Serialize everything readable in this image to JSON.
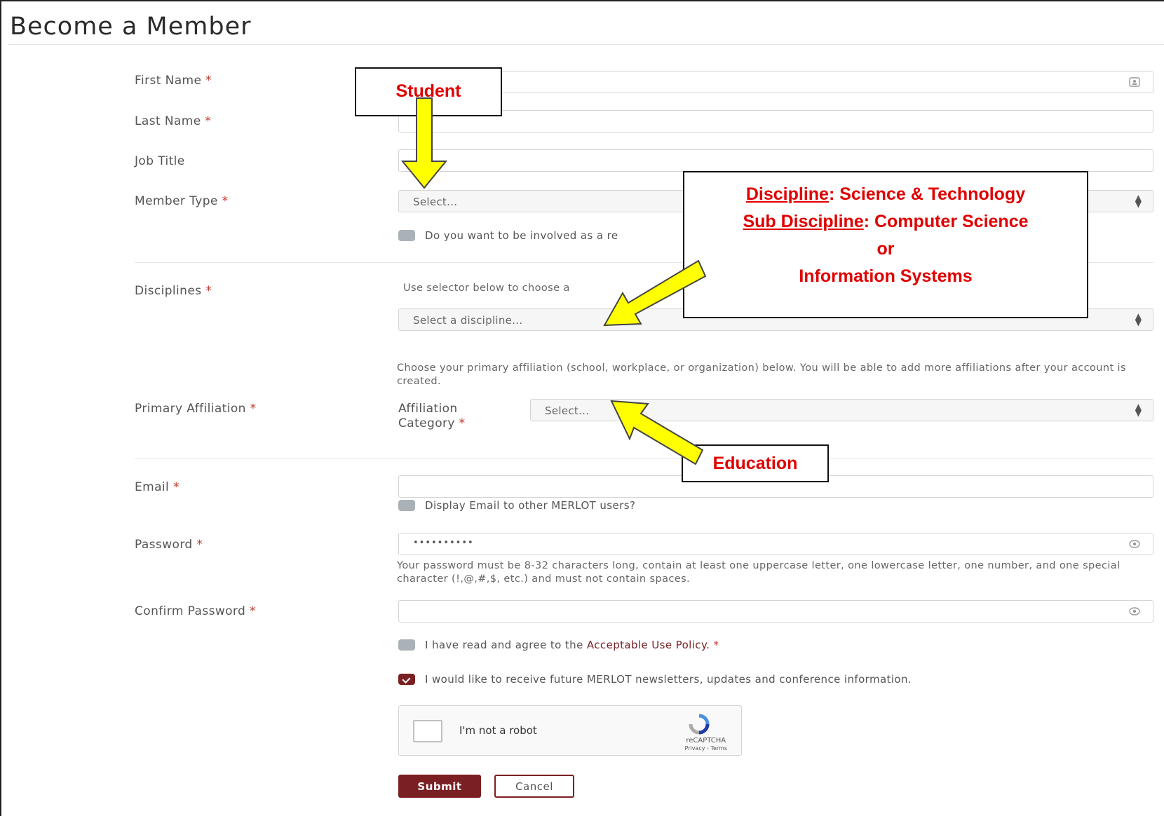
{
  "page": {
    "title": "Become a Member"
  },
  "form": {
    "first_name_label": "First Name",
    "last_name_label": "Last Name",
    "job_title_label": "Job Title",
    "member_type_label": "Member Type",
    "member_type_value": "Select...",
    "reviewer_checkbox_label": "Do you want to be involved as a re",
    "disciplines_label": "Disciplines",
    "disciplines_help": "Use selector below to choose a",
    "discipline_select_value": "Select a discipline...",
    "affiliation_help": "Choose your primary affiliation (school, workplace, or organization) below. You will be able to add more affiliations after your account is created.",
    "primary_affiliation_label": "Primary Affiliation",
    "affiliation_category_label_1": "Affiliation",
    "affiliation_category_label_2": "Category",
    "affiliation_category_value": "Select...",
    "email_label": "Email",
    "display_email_label": "Display Email to other MERLOT users?",
    "password_label": "Password",
    "password_value": "••••••••••",
    "password_help": "Your password must be 8-32 characters long, contain at least one uppercase letter, one lowercase letter, one number, and one special character (!,@,#,$, etc.) and must not contain spaces.",
    "confirm_password_label": "Confirm Password",
    "aup_text_before": "I have read and agree to the ",
    "aup_link": "Acceptable Use Policy.",
    "newsletter_label": "I would like to receive future MERLOT newsletters, updates and conference information.",
    "required_marker": "*"
  },
  "captcha": {
    "label": "I'm not a robot",
    "brand": "reCAPTCHA",
    "links": "Privacy - Terms"
  },
  "buttons": {
    "submit": "Submit",
    "cancel": "Cancel"
  },
  "annotations": {
    "student": "Student",
    "discipline_key": "Discipline",
    "discipline_value": ": Science & Technology",
    "subdiscipline_key": "Sub Discipline",
    "subdiscipline_value": ": Computer Science",
    "or": "or",
    "info_systems": "Information Systems",
    "education": "Education"
  },
  "colors": {
    "brand": "#7a1f22",
    "annotation_text": "#e00000",
    "arrow_fill": "#ffff00"
  },
  "icons": [
    "contact-card-icon",
    "select-caret-icon",
    "eye-icon",
    "recaptcha-logo-icon"
  ]
}
